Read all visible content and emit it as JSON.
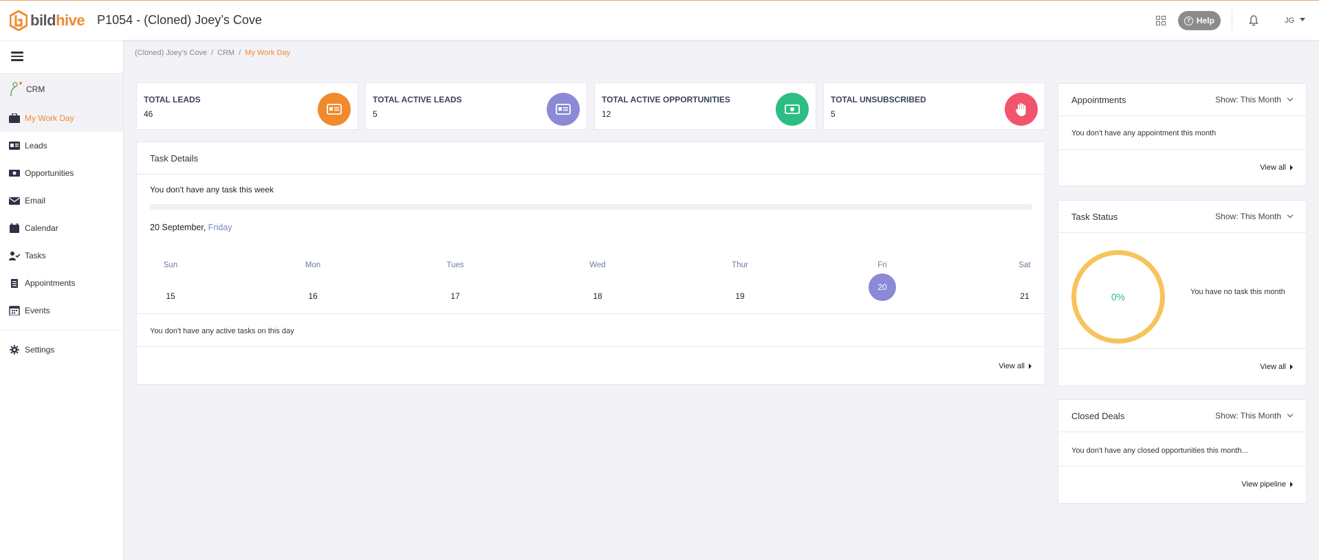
{
  "app": {
    "logo_prefix": "bild",
    "logo_suffix": "hive",
    "project_title": "P1054 - (Cloned) Joey’s Cove",
    "help_label": "Help",
    "user_initials": "JG"
  },
  "colors": {
    "accent": "#f08a2c",
    "leads": "#f08a2c",
    "active_leads": "#8b8ad6",
    "opportunities": "#2dbd84",
    "unsubscribed": "#f2546e",
    "donut": "#f7c35c"
  },
  "sidebar": {
    "module": "CRM",
    "items": [
      {
        "label": "My Work Day",
        "icon": "briefcase-icon"
      },
      {
        "label": "Leads",
        "icon": "id-card-icon"
      },
      {
        "label": "Opportunities",
        "icon": "money-icon"
      },
      {
        "label": "Email",
        "icon": "envelope-icon"
      },
      {
        "label": "Calendar",
        "icon": "calendar-icon"
      },
      {
        "label": "Tasks",
        "icon": "user-check-icon"
      },
      {
        "label": "Appointments",
        "icon": "clipboard-icon"
      },
      {
        "label": "Events",
        "icon": "calendar-grid-icon"
      }
    ],
    "settings": "Settings"
  },
  "breadcrumb": [
    "(Cloned) Joey’s Cove",
    "CRM",
    "My Work Day"
  ],
  "stats": [
    {
      "label": "TOTAL LEADS",
      "value": "46"
    },
    {
      "label": "TOTAL ACTIVE LEADS",
      "value": "5"
    },
    {
      "label": "TOTAL ACTIVE OPPORTUNITIES",
      "value": "12"
    },
    {
      "label": "TOTAL UNSUBSCRIBED",
      "value": "5"
    }
  ],
  "tasks": {
    "title": "Task Details",
    "empty_week": "You don't have any task this week",
    "date_prefix": "20 September,",
    "date_day": "Friday",
    "week": [
      {
        "name": "Sun",
        "num": "15"
      },
      {
        "name": "Mon",
        "num": "16"
      },
      {
        "name": "Tues",
        "num": "17"
      },
      {
        "name": "Wed",
        "num": "18"
      },
      {
        "name": "Thur",
        "num": "19"
      },
      {
        "name": "Fri",
        "num": "20"
      },
      {
        "name": "Sat",
        "num": "21"
      }
    ],
    "no_active": "You don't have any active tasks on this day",
    "view_all": "View all"
  },
  "appointments": {
    "title": "Appointments",
    "show": "Show: This Month",
    "message": "You don't have any appointment this month",
    "view_all": "View all"
  },
  "task_status": {
    "title": "Task Status",
    "show": "Show: This Month",
    "percent": "0%",
    "message": "You have no task this month",
    "view_all": "View all"
  },
  "closed_deals": {
    "title": "Closed Deals",
    "show": "Show: This Month",
    "message": "You don't have any closed opportunities this month...",
    "view_pipeline": "View pipeline"
  }
}
